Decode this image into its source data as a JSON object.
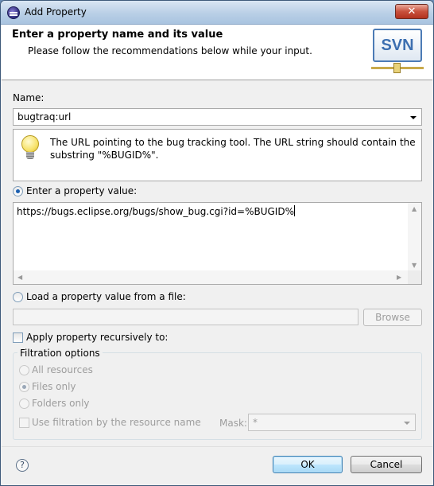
{
  "window": {
    "title": "Add Property",
    "close_glyph": "✕"
  },
  "banner": {
    "title": "Enter a property name and its value",
    "subtitle": "Please follow the recommendations below while your input.",
    "logo_text": "SVN"
  },
  "name_field": {
    "label": "Name:",
    "value": "bugtraq:url"
  },
  "info": {
    "text": "The URL pointing to the bug tracking tool. The URL string should contain the substring \"%BUGID%\"."
  },
  "value_option": {
    "label": "Enter a property value:",
    "selected": true,
    "text": "https://bugs.eclipse.org/bugs/show_bug.cgi?id=%BUGID%"
  },
  "file_option": {
    "label": "Load a property value from a file:",
    "selected": false,
    "path": "",
    "browse_label": "Browse"
  },
  "recursive": {
    "label": "Apply property recursively to:",
    "checked": false
  },
  "filtration": {
    "title": "Filtration options",
    "options": [
      {
        "label": "All resources",
        "selected": false
      },
      {
        "label": "Files only",
        "selected": true
      },
      {
        "label": "Folders only",
        "selected": false
      }
    ],
    "use_name_label": "Use filtration by the resource name",
    "mask_label": "Mask:",
    "mask_value": "*"
  },
  "footer": {
    "help_glyph": "?",
    "ok_label": "OK",
    "cancel_label": "Cancel"
  },
  "colors": {
    "accent": "#3c7fb1",
    "banner_bg": "#ffffff",
    "dialog_bg": "#f0f0f0"
  }
}
